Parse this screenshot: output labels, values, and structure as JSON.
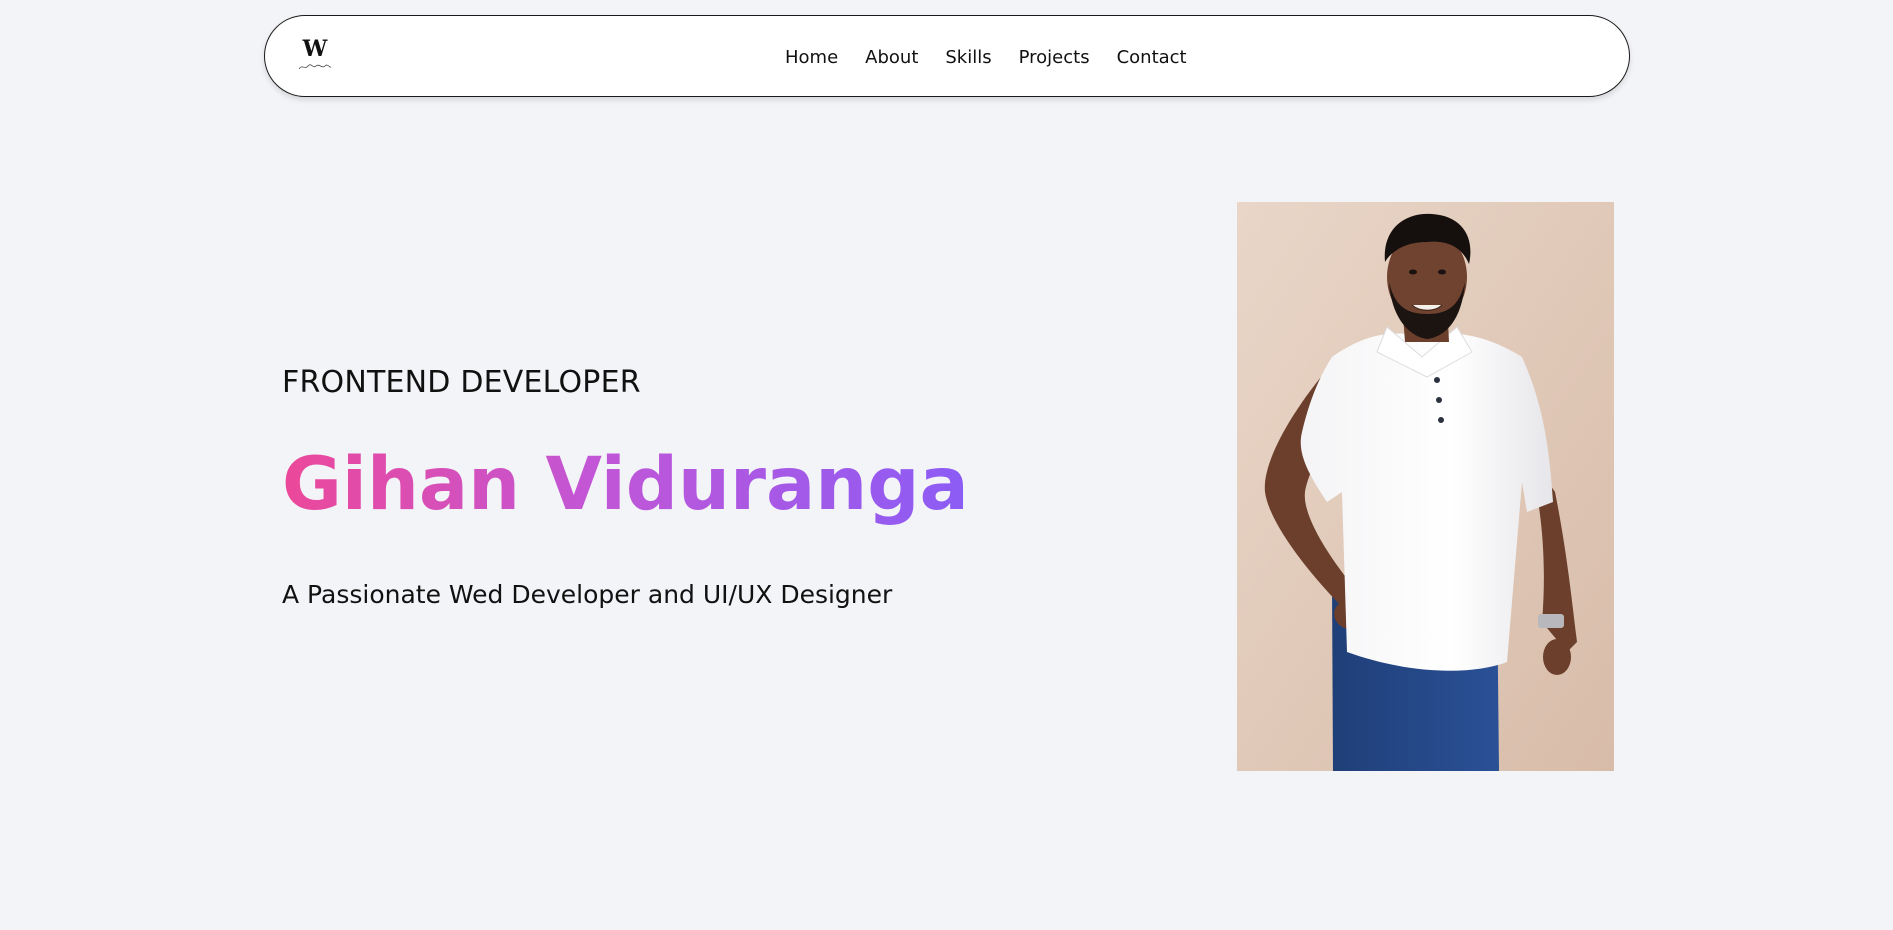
{
  "navbar": {
    "logo": {
      "letter": "W",
      "icon": "signature-logo-icon"
    },
    "links": [
      {
        "label": "Home"
      },
      {
        "label": "About"
      },
      {
        "label": "Skills"
      },
      {
        "label": "Projects"
      },
      {
        "label": "Contact"
      }
    ]
  },
  "hero": {
    "role": "FRONTEND DEVELOPER",
    "name": "Gihan Viduranga",
    "tagline": "A Passionate Wed Developer and UI/UX Designer",
    "name_gradient": [
      "#ec4899",
      "#8b5cf6"
    ]
  },
  "photo": {
    "subject": "portrait-photo"
  },
  "colors": {
    "background": "#f3f4f8",
    "navbar_bg": "#ffffff",
    "text": "#111111"
  }
}
